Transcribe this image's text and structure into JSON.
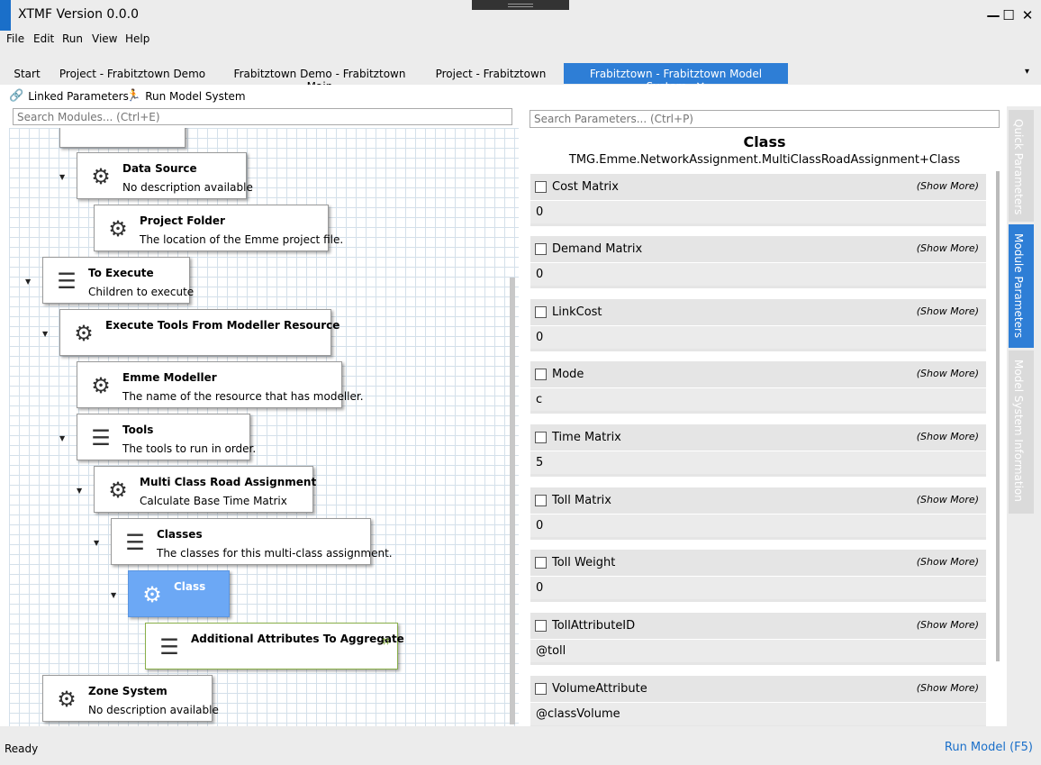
{
  "window": {
    "title": "XTMF Version 0.0.0",
    "minimize": "—",
    "maximize": "☐",
    "close": "✕"
  },
  "menu": [
    "File",
    "Edit",
    "Run",
    "View",
    "Help"
  ],
  "tabs": [
    "Start",
    "Project - Frabitztown Demo",
    "Frabitztown Demo - Frabitztown Main",
    "Project - Frabitztown",
    "Frabitztown - Frabitztown Model System"
  ],
  "active_tab_close": "✕",
  "toolbar": {
    "linked": "Linked Parameters",
    "run": "Run Model System"
  },
  "module_search": {
    "placeholder": "Search Modules... (Ctrl+E)"
  },
  "modules": [
    {
      "name": "Data Source",
      "desc": "No description available"
    },
    {
      "name": "Project Folder",
      "desc": "The location of the Emme project file."
    },
    {
      "name": "To Execute",
      "desc": "Children to execute"
    },
    {
      "name": "Execute Tools From Modeller Resource",
      "desc": ""
    },
    {
      "name": "Emme Modeller",
      "desc": "The name of the resource that has modeller."
    },
    {
      "name": "Tools",
      "desc": "The tools to run in order."
    },
    {
      "name": "Multi Class Road Assignment",
      "desc": "Calculate Base Time Matrix"
    },
    {
      "name": "Classes",
      "desc": "The classes for this multi-class assignment."
    },
    {
      "name": "Class",
      "desc": ""
    },
    {
      "name": "Additional Attributes To Aggregate",
      "desc": ""
    },
    {
      "name": "Zone System",
      "desc": "No description available"
    }
  ],
  "param_search": {
    "placeholder": "Search Parameters... (Ctrl+P)"
  },
  "selected_module": {
    "title": "Class",
    "full_name": "TMG.Emme.NetworkAssignment.MultiClassRoadAssignment+Class"
  },
  "show_more": "(Show More)",
  "parameters": [
    {
      "name": "Cost Matrix",
      "value": "0"
    },
    {
      "name": "Demand Matrix",
      "value": "0"
    },
    {
      "name": "LinkCost",
      "value": "0"
    },
    {
      "name": "Mode",
      "value": "c"
    },
    {
      "name": "Time Matrix",
      "value": "5"
    },
    {
      "name": "Toll Matrix",
      "value": "0"
    },
    {
      "name": "Toll Weight",
      "value": "0"
    },
    {
      "name": "TollAttributeID",
      "value": "@toll"
    },
    {
      "name": "VolumeAttribute",
      "value": "@classVolume"
    }
  ],
  "side_tabs": [
    "Quick Parameters",
    "Module Parameters",
    "Model System Information"
  ],
  "status": {
    "ready": "Ready",
    "run_model": "Run Model (F5)"
  },
  "colors": {
    "accent": "#2e7ed6",
    "selected_module": "#6ca8f5"
  }
}
